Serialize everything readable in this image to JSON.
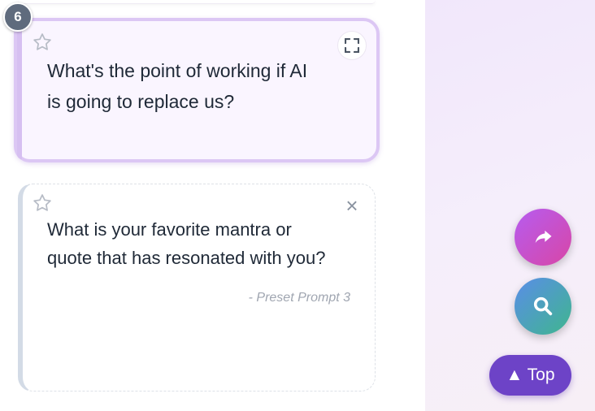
{
  "cards": [
    {
      "number": "6",
      "text_line1": "What's the point of working if AI",
      "text_line2": "is going to replace us?",
      "expand_icon": "expand-icon",
      "star_icon": "star-icon"
    },
    {
      "text_line1": "What is your favorite mantra or",
      "text_line2": "quote that has resonated with you?",
      "tag": "- Preset Prompt 3",
      "close_label": "×",
      "star_icon": "star-icon"
    }
  ],
  "fabs": {
    "share_icon": "share-arrow-icon",
    "search_icon": "search-icon",
    "top_label": "▲ Top"
  },
  "colors": {
    "active_card_bg": "#faf5ff",
    "active_card_border": "#dcc7f4",
    "share_gradient": [
      "#b65cf0",
      "#d846a6"
    ],
    "search_gradient": [
      "#5a8de8",
      "#3fb68e"
    ],
    "top_button": "#6d43c7",
    "badge": "#5f6b7d"
  }
}
